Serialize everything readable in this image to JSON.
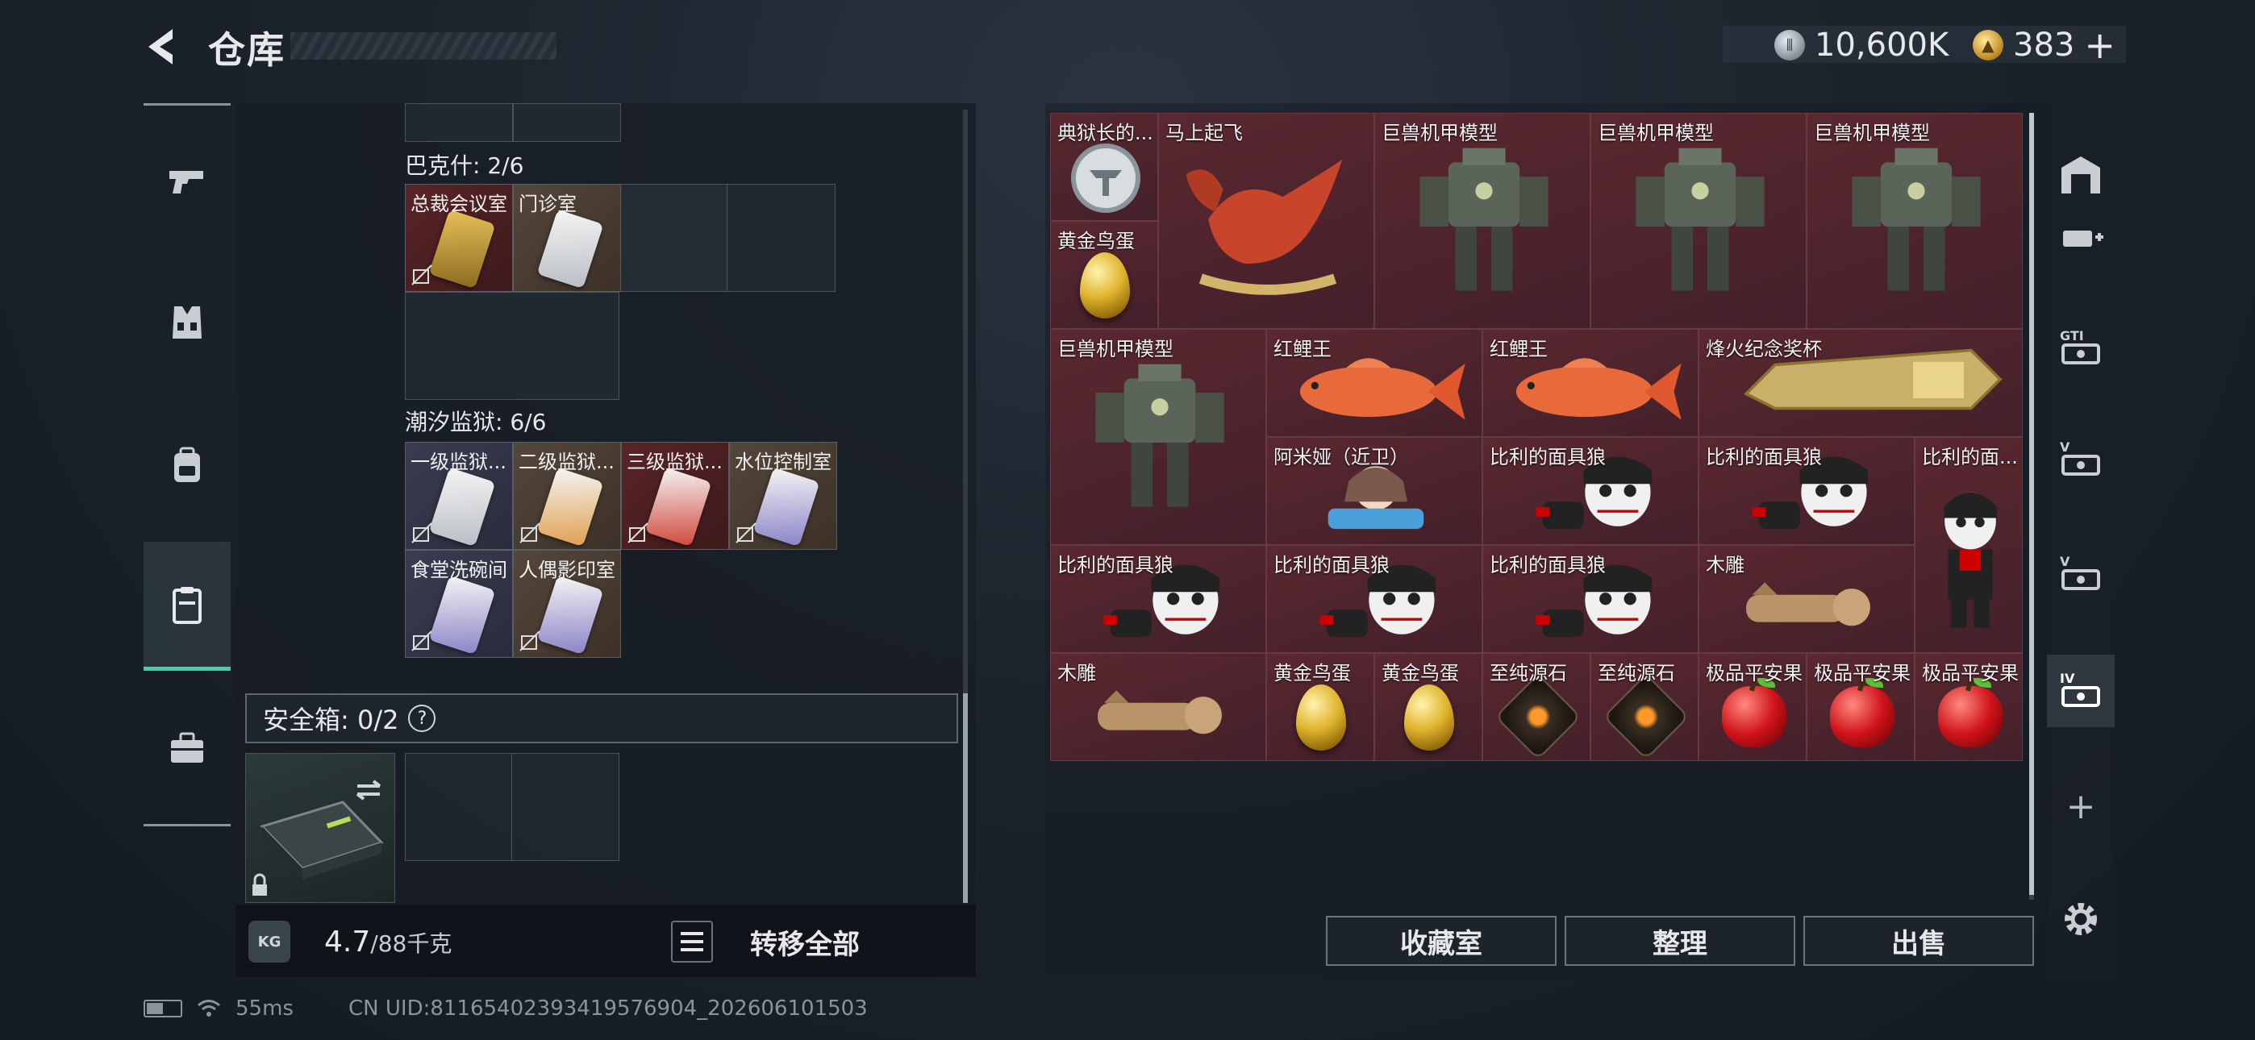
{
  "header": {
    "title": "仓库",
    "currency_1": "10,600K",
    "currency_2": "383",
    "add_symbol": "+"
  },
  "left_nav": {
    "items": [
      {
        "name": "weapons",
        "icon": "pistol-icon"
      },
      {
        "name": "armor",
        "icon": "vest-icon"
      },
      {
        "name": "backpack",
        "icon": "backpack-icon"
      },
      {
        "name": "storage",
        "icon": "clipboard-icon",
        "active": true
      },
      {
        "name": "medkit",
        "icon": "toolbox-icon"
      }
    ]
  },
  "left_panel": {
    "sections": [
      {
        "title": "巴克什: 2/6",
        "keys": [
          {
            "label": "总裁会议室",
            "style": "red"
          },
          {
            "label": "门诊室",
            "style": "tan"
          }
        ]
      },
      {
        "title": "潮汐监狱: 6/6",
        "keys": [
          {
            "label": "一级监狱...",
            "style": "blue"
          },
          {
            "label": "二级监狱...",
            "style": "tan"
          },
          {
            "label": "三级监狱...",
            "style": "red"
          },
          {
            "label": "水位控制室",
            "style": "tan"
          },
          {
            "label": "食堂洗碗间",
            "style": "blue"
          },
          {
            "label": "人偶影印室",
            "style": "tan"
          }
        ]
      }
    ],
    "safe_box": {
      "label": "安全箱: 0/2",
      "help": "?"
    },
    "weight": {
      "current": "4.7",
      "max": "/88千克"
    },
    "transfer_all": "转移全部"
  },
  "right_panel": {
    "items": [
      {
        "label": "典狱长的..."
      },
      {
        "label": "马上起飞"
      },
      {
        "label": "巨兽机甲模型"
      },
      {
        "label": "巨兽机甲模型"
      },
      {
        "label": "巨兽机甲模型"
      },
      {
        "label": "黄金鸟蛋"
      },
      {
        "label": "巨兽机甲模型"
      },
      {
        "label": "红鲤王"
      },
      {
        "label": "红鲤王"
      },
      {
        "label": "烽火纪念奖杯"
      },
      {
        "label": "阿米娅（近卫）"
      },
      {
        "label": "比利的面具狼"
      },
      {
        "label": "比利的面具狼"
      },
      {
        "label": "比利的面..."
      },
      {
        "label": "比利的面具狼"
      },
      {
        "label": "比利的面具狼"
      },
      {
        "label": "比利的面具狼"
      },
      {
        "label": "木雕"
      },
      {
        "label": "木雕"
      },
      {
        "label": "黄金鸟蛋"
      },
      {
        "label": "黄金鸟蛋"
      },
      {
        "label": "至纯源石"
      },
      {
        "label": "至纯源石"
      },
      {
        "label": "极品平安果"
      },
      {
        "label": "极品平安果"
      },
      {
        "label": "极品平安果"
      }
    ],
    "buttons": {
      "collection": "收藏室",
      "sort": "整理",
      "sell": "出售"
    }
  },
  "right_nav": {
    "items": [
      "warehouse-icon",
      "container-add-icon",
      "gti-icon",
      "case-v-icon",
      "case-v2-icon",
      "case-iv-icon"
    ],
    "add_symbol": "+"
  },
  "status": {
    "ping": "55ms",
    "uid": "CN UID:8116540239341957​6904_202606101503"
  },
  "colors": {
    "accent_green": "#3fd3a6",
    "item_bg_red": "#4a1f26"
  }
}
